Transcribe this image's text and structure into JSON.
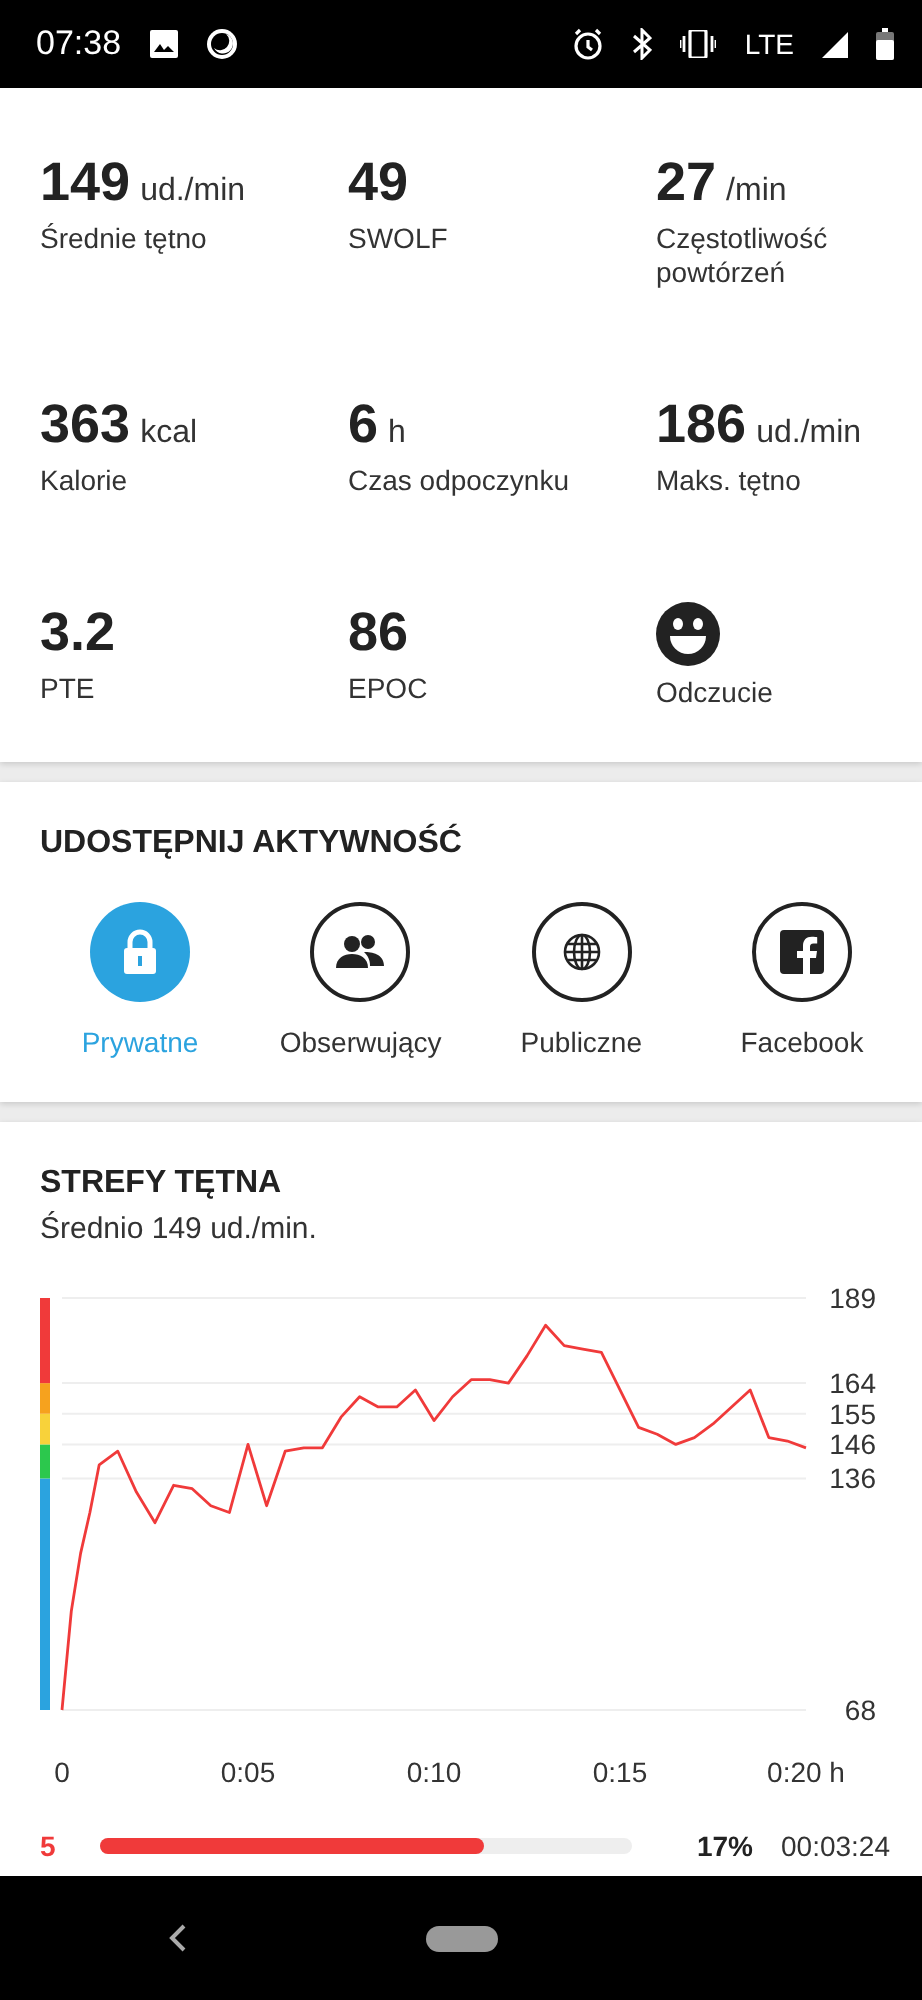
{
  "status_bar": {
    "time": "07:38",
    "network": "LTE"
  },
  "stats": [
    {
      "kind": "value",
      "value": "149",
      "unit": "ud./min",
      "label": "Średnie tętno"
    },
    {
      "kind": "value",
      "value": "49",
      "label": "SWOLF"
    },
    {
      "kind": "value",
      "value": "27",
      "unit": "/min",
      "label": "Częstotliwość powtórzeń"
    },
    {
      "kind": "value",
      "value": "363",
      "unit": "kcal",
      "label": "Kalorie"
    },
    {
      "kind": "value",
      "value": "6",
      "unit": "h",
      "label": "Czas odpoczynku"
    },
    {
      "kind": "value",
      "value": "186",
      "unit": "ud./min",
      "label": "Maks. tętno"
    },
    {
      "kind": "value",
      "value": "3.2",
      "label": "PTE"
    },
    {
      "kind": "value",
      "value": "86",
      "label": "EPOC"
    },
    {
      "kind": "face",
      "label": "Odczucie"
    }
  ],
  "share": {
    "title": "UDOSTĘPNIJ AKTYWNOŚĆ",
    "options": [
      {
        "kind": "private",
        "label": "Prywatne",
        "selected": true
      },
      {
        "kind": "followers",
        "label": "Obserwujący",
        "selected": false
      },
      {
        "kind": "public",
        "label": "Publiczne",
        "selected": false
      },
      {
        "kind": "facebook",
        "label": "Facebook",
        "selected": false
      }
    ]
  },
  "heart_rate_zones": {
    "title": "STREFY TĘTNA",
    "subtitle": "Średnio 149 ud./min.",
    "chart_data": {
      "type": "line",
      "x": [
        0,
        0.25,
        0.5,
        0.75,
        1,
        1.5,
        2,
        2.5,
        3,
        3.5,
        4,
        4.5,
        5,
        5.5,
        6,
        6.5,
        7,
        7.5,
        8,
        8.5,
        9,
        9.5,
        10,
        10.5,
        11,
        11.5,
        12,
        12.5,
        13,
        13.5,
        14,
        14.5,
        15,
        15.5,
        16,
        16.5,
        17,
        17.5,
        18,
        18.5,
        19,
        19.5,
        20
      ],
      "series": [
        {
          "color": "#f03a3a",
          "values": [
            68,
            97,
            114,
            126,
            140,
            144,
            132,
            123,
            134,
            133,
            128,
            126,
            146,
            128,
            144,
            145,
            145,
            154,
            160,
            157,
            157,
            162,
            153,
            160,
            165,
            165,
            164,
            172,
            181,
            175,
            174,
            173,
            162,
            151,
            149,
            146,
            148,
            152,
            157,
            162,
            148,
            147,
            145
          ]
        }
      ],
      "xlim": [
        0,
        20
      ],
      "ylim": [
        68,
        189
      ],
      "xticks": [
        {
          "value": 0,
          "label": "0"
        },
        {
          "value": 5,
          "label": "0:05"
        },
        {
          "value": 10,
          "label": "0:10"
        },
        {
          "value": 15,
          "label": "0:15"
        },
        {
          "value": 20,
          "label": "0:20 h"
        }
      ],
      "yticks": [
        68,
        136,
        146,
        155,
        164,
        189
      ],
      "grid": true
    },
    "zones": [
      {
        "zone": "5",
        "color": "#f03a3a",
        "level": 0.72,
        "percent": "17%",
        "duration": "00:03:24"
      }
    ]
  }
}
